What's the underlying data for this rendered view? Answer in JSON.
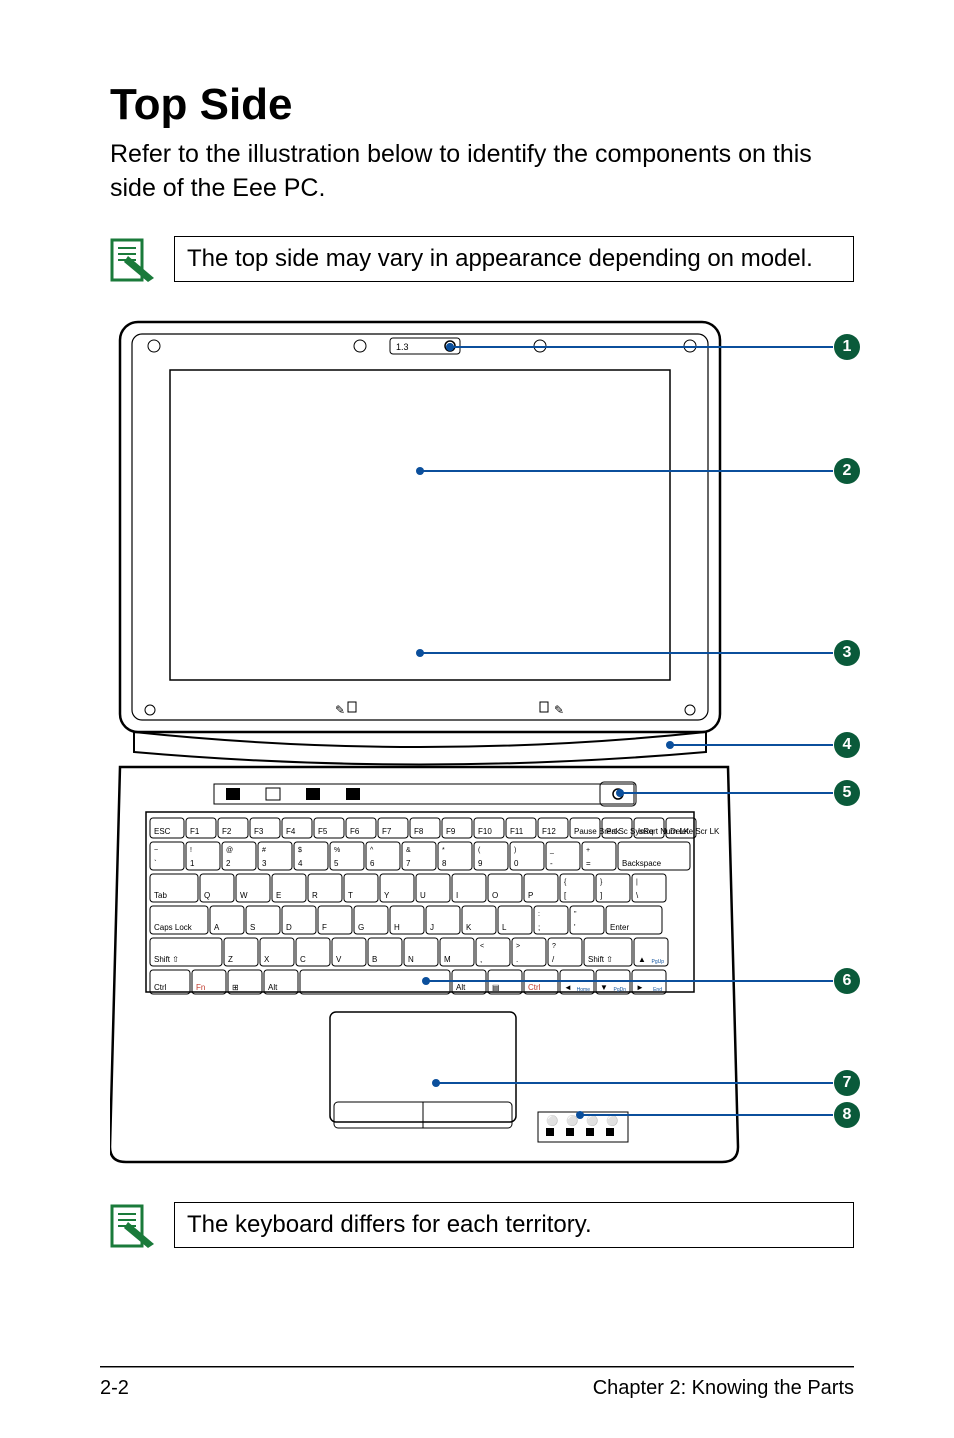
{
  "heading": "Top Side",
  "intro": "Refer to the illustration below to identify the components on this side of the Eee PC.",
  "note_top": "The top side may vary in appearance depending on model.",
  "note_bottom": "The keyboard differs for each territory.",
  "callouts": [
    "1",
    "2",
    "3",
    "4",
    "5",
    "6",
    "7",
    "8"
  ],
  "footer_left": "2-2",
  "footer_right": "Chapter 2: Knowing the Parts",
  "keyboard": {
    "row_fn": [
      "ESC",
      "F1",
      "F2",
      "F3",
      "F4",
      "F5",
      "F6",
      "F7",
      "F8",
      "F9",
      "F10",
      "F11",
      "F12",
      "Pause Break",
      "Prt Sc SysRq",
      "Insert Num LK",
      "Delete Scr LK"
    ],
    "row_num_top": [
      "~",
      "!",
      "@",
      "#",
      "$",
      "%",
      "^",
      "&",
      "*",
      "(",
      ")",
      "_",
      "+"
    ],
    "row_num_bot": [
      "`",
      "1",
      "2",
      "3",
      "4",
      "5",
      "6",
      "7",
      "8",
      "9",
      "0",
      "-",
      "="
    ],
    "row_num_right": "Backspace",
    "row_q": [
      "Tab",
      "Q",
      "W",
      "E",
      "R",
      "T",
      "Y",
      "U",
      "I",
      "O",
      "P",
      "[",
      "]",
      "\\"
    ],
    "row_q_brk_top": [
      "{",
      "}",
      "|"
    ],
    "row_a": [
      "Caps Lock",
      "A",
      "S",
      "D",
      "F",
      "G",
      "H",
      "J",
      "K",
      "L",
      ";",
      "'",
      "Enter"
    ],
    "row_a_top": [
      "",
      ":",
      "\""
    ],
    "row_z": [
      "Shift",
      "Z",
      "X",
      "C",
      "V",
      "B",
      "N",
      "M",
      ",",
      ".",
      "/",
      "Shift",
      "▲"
    ],
    "row_z_top": [
      "<",
      ">",
      "?"
    ],
    "row_ctrl": [
      "Ctrl",
      "Fn",
      "",
      "Alt",
      "",
      "",
      "Alt",
      "",
      "Ctrl",
      "◄",
      "▼",
      "►"
    ],
    "arrow_sub": [
      "Home",
      "PgDn",
      "End"
    ]
  }
}
